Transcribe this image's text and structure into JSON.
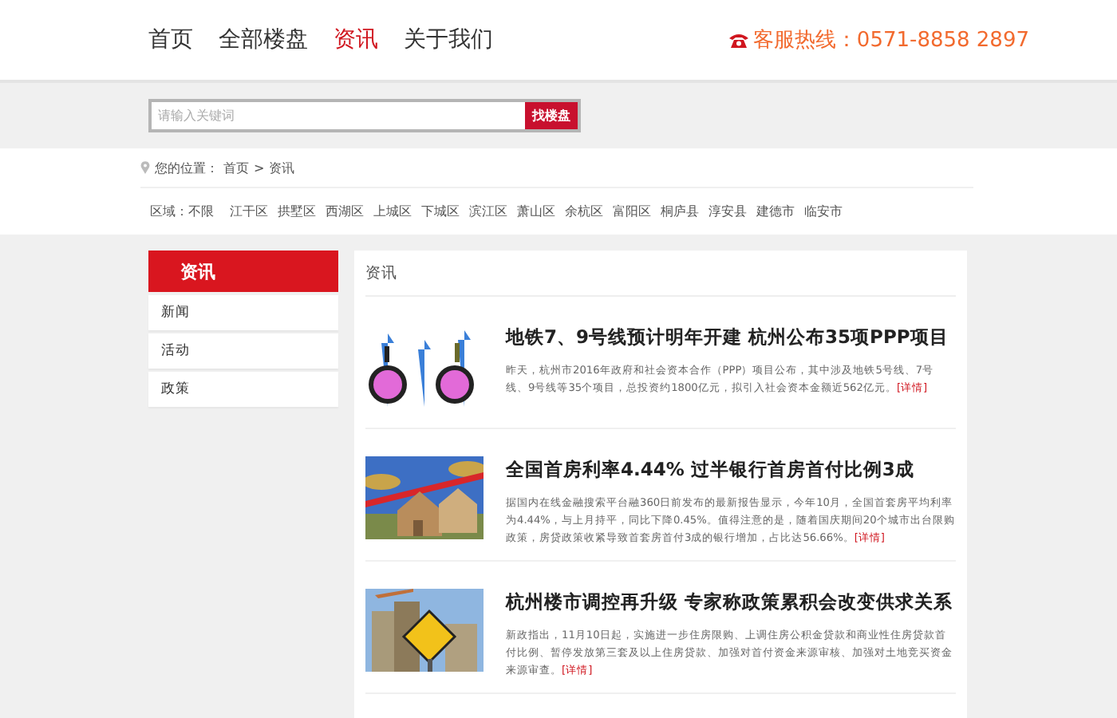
{
  "nav": {
    "items": [
      {
        "label": "首页",
        "selected": false
      },
      {
        "label": "全部楼盘",
        "selected": false
      },
      {
        "label": "资讯",
        "selected": true
      },
      {
        "label": "关于我们",
        "selected": false
      }
    ],
    "hotline": "客服热线：0571-8858 2897"
  },
  "search": {
    "placeholder": "请输入关键词",
    "button": "找楼盘"
  },
  "breadcrumb": {
    "label": "您的位置：",
    "items": [
      "首页",
      "资讯"
    ],
    "separator": ">"
  },
  "region": {
    "label": "区域：",
    "options": [
      "不限",
      "江干区",
      "拱墅区",
      "西湖区",
      "上城区",
      "下城区",
      "滨江区",
      "萧山区",
      "余杭区",
      "富阳区",
      "桐庐县",
      "淳安县",
      "建德市",
      "临安市"
    ]
  },
  "sidebar": {
    "title": "资讯",
    "items": [
      "新闻",
      "活动",
      "政策"
    ]
  },
  "content": {
    "title": "资讯",
    "articles": [
      {
        "title": "地铁7、9号线预计明年开建 杭州公布35项PPP项目",
        "summary": "昨天，杭州市2016年政府和社会资本合作（PPP）项目公布，其中涉及地铁5号线、7号线、9号线等35个项目，总投资约1800亿元，拟引入社会资本金额近562亿元。",
        "more": "[详情]"
      },
      {
        "title": "全国首房利率4.44% 过半银行首房首付比例3成",
        "summary": "据国内在线金融搜索平台融360日前发布的最新报告显示，今年10月，全国首套房平均利率为4.44%，与上月持平，同比下降0.45%。值得注意的是，随着国庆期间20个城市出台限购政策，房贷政策收紧导致首套房首付3成的银行增加，占比达56.66%。",
        "more": "[详情]"
      },
      {
        "title": "杭州楼市调控再升级 专家称政策累积会改变供求关系",
        "summary": "新政指出，11月10日起，实施进一步住房限购、上调住房公积金贷款和商业性住房贷款首付比例、暂停发放第三套及以上住房贷款、加强对首付资金来源审核、加强对土地竞买资金来源审查。",
        "more": "[详情]"
      }
    ]
  }
}
